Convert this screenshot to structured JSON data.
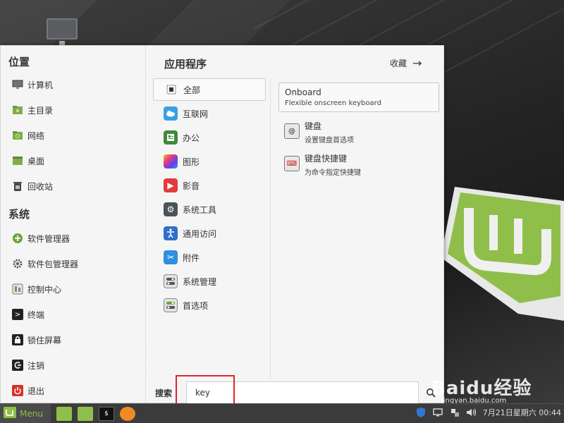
{
  "menu": {
    "places_title": "位置",
    "places": [
      {
        "label": "计算机",
        "icon": "monitor-icon"
      },
      {
        "label": "主目录",
        "icon": "home-folder-icon"
      },
      {
        "label": "网络",
        "icon": "network-folder-icon"
      },
      {
        "label": "桌面",
        "icon": "desktop-folder-icon"
      },
      {
        "label": "回收站",
        "icon": "trash-icon"
      }
    ],
    "system_title": "系统",
    "system": [
      {
        "label": "软件管理器",
        "icon": "software-manager-icon"
      },
      {
        "label": "软件包管理器",
        "icon": "package-manager-icon"
      },
      {
        "label": "控制中心",
        "icon": "control-center-icon"
      },
      {
        "label": "终端",
        "icon": "terminal-icon"
      },
      {
        "label": "锁住屏幕",
        "icon": "lock-icon"
      },
      {
        "label": "注销",
        "icon": "logout-icon"
      },
      {
        "label": "退出",
        "icon": "power-icon"
      }
    ],
    "categories_title": "应用程序",
    "favorites_label": "收藏",
    "categories": [
      {
        "label": "全部",
        "icon": "all-apps-icon",
        "selected": true
      },
      {
        "label": "互联网",
        "icon": "internet-icon"
      },
      {
        "label": "办公",
        "icon": "office-icon"
      },
      {
        "label": "图形",
        "icon": "graphics-icon"
      },
      {
        "label": "影音",
        "icon": "multimedia-icon"
      },
      {
        "label": "系统工具",
        "icon": "system-tools-icon"
      },
      {
        "label": "通用访问",
        "icon": "accessibility-icon"
      },
      {
        "label": "附件",
        "icon": "accessories-icon"
      },
      {
        "label": "系统管理",
        "icon": "administration-icon"
      },
      {
        "label": "首选项",
        "icon": "preferences-icon"
      }
    ],
    "apps": [
      {
        "name": "Onboard",
        "desc": "Flexible onscreen keyboard",
        "selected": true
      },
      {
        "name": "键盘",
        "desc": "设置键盘首选项",
        "icon": "keyboard-icon"
      },
      {
        "name": "键盘快捷键",
        "desc": "为命令指定快捷键",
        "icon": "keyboard-shortcuts-icon"
      }
    ],
    "search": {
      "label": "搜索",
      "value": "key"
    }
  },
  "taskbar": {
    "menu_label": "Menu",
    "clock": "7月21日星期六 00:44"
  },
  "watermark": {
    "brand": "Baidu经验",
    "url": "jingyan.baidu.com"
  },
  "colors": {
    "mint_green": "#8fbf4a",
    "highlight": "#e0242b"
  }
}
